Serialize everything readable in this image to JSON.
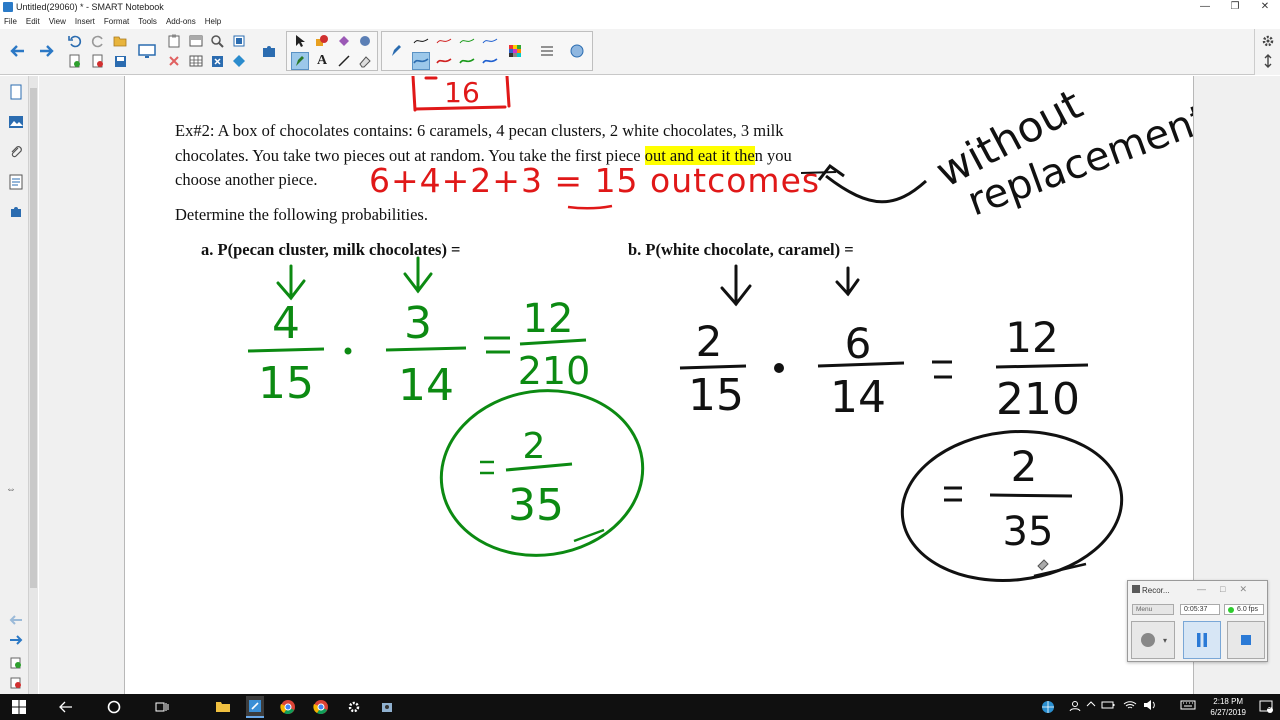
{
  "window": {
    "title": "Untitled(29060) * - SMART Notebook",
    "controls": [
      "—",
      "❐",
      "✕"
    ]
  },
  "menu": [
    "File",
    "Edit",
    "View",
    "Insert",
    "Format",
    "Tools",
    "Add-ons",
    "Help"
  ],
  "problem": {
    "line1": "Ex#2: A box of chocolates contains: 6 caramels, 4 pecan clusters, 2 white chocolates, 3 milk",
    "line2_before": "chocolates.  You take two pieces out at random.  You take the first piece ",
    "line2_highlight": "out and eat it the",
    "line2_after": "n you",
    "line3": "choose another piece.",
    "line4": "Determine the following probabilities.",
    "part_a": "a.  P(pecan cluster, milk chocolates) =",
    "part_b": "b. P(white chocolate, caramel) ="
  },
  "handwriting": {
    "top_partial": "16",
    "sum": "6+4+2+3 = 15 outcomes",
    "note_line1": "without",
    "note_line2": "replacement",
    "a_num1": "4",
    "a_den1": "15",
    "a_num2": "3",
    "a_den2": "14",
    "a_result_num": "12",
    "a_result_den": "210",
    "a_simpl_num": "2",
    "a_simpl_den": "35",
    "b_num1": "2",
    "b_den1": "15",
    "b_num2": "6",
    "b_den2": "14",
    "b_result_num": "12",
    "b_result_den": "210",
    "b_simpl_num": "2",
    "b_simpl_den": "35",
    "colors": {
      "red": "#e01818",
      "green": "#0c8a12",
      "black": "#111111"
    }
  },
  "recorder": {
    "title": "Recor...",
    "menu_label": "Menu",
    "elapsed": "0:05:37",
    "fps": "6.0 fps"
  },
  "taskbar": {
    "time": "2:18 PM",
    "date": "6/27/2019",
    "notification_count": "3"
  }
}
